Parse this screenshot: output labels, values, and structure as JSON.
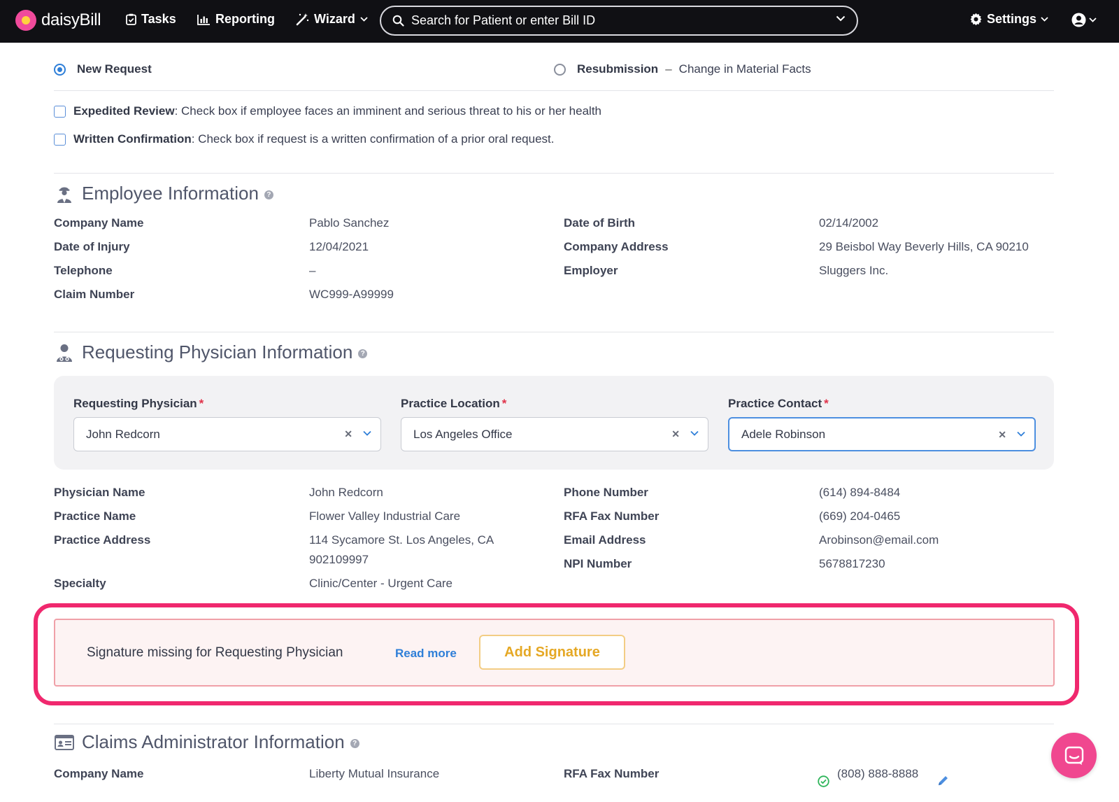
{
  "nav": {
    "brand": "daisyBill",
    "tasks": "Tasks",
    "reporting": "Reporting",
    "wizard": "Wizard",
    "search_placeholder": "Search for Patient or enter Bill ID",
    "settings": "Settings"
  },
  "request_type": {
    "new_request": "New Request",
    "resubmission": "Resubmission",
    "resubmission_dash": "–",
    "resubmission_detail": "Change in Material Facts",
    "selected": "New Request"
  },
  "checkboxes": [
    {
      "label": "Expedited Review",
      "text": ": Check box if employee faces an imminent and serious threat to his or her health"
    },
    {
      "label": "Written Confirmation",
      "text": ": Check box if request is a written confirmation of a prior oral request."
    }
  ],
  "employee": {
    "title": "Employee Information",
    "left": [
      {
        "label": "Company Name",
        "value": "Pablo Sanchez"
      },
      {
        "label": "Date of Injury",
        "value": "12/04/2021"
      },
      {
        "label": "Telephone",
        "value": "–"
      },
      {
        "label": "Claim Number",
        "value": "WC999-A99999"
      }
    ],
    "right": [
      {
        "label": "Date of Birth",
        "value": "02/14/2002"
      },
      {
        "label": "Company Address",
        "value": "29 Beisbol Way Beverly Hills, CA 90210"
      },
      {
        "label": "Employer",
        "value": "Sluggers Inc."
      }
    ]
  },
  "physician": {
    "title": "Requesting Physician Information",
    "selects": [
      {
        "label": "Requesting Physician",
        "required": "*",
        "value": "John Redcorn"
      },
      {
        "label": "Practice Location",
        "required": "*",
        "value": "Los Angeles Office"
      },
      {
        "label": "Practice Contact",
        "required": "*",
        "value": "Adele Robinson"
      }
    ],
    "left": [
      {
        "label": "Physician Name",
        "value": "John Redcorn"
      },
      {
        "label": "Practice Name",
        "value": "Flower Valley Industrial Care"
      },
      {
        "label": "Practice Address",
        "value": "114 Sycamore St. Los Angeles, CA",
        "value2": "902109997"
      },
      {
        "label": "Specialty",
        "value": "Clinic/Center - Urgent Care"
      }
    ],
    "right": [
      {
        "label": "Phone Number",
        "value": "(614) 894-8484"
      },
      {
        "label": "RFA Fax Number",
        "value": "(669) 204-0465"
      },
      {
        "label": "Email Address",
        "value": "Arobinson@email.com"
      },
      {
        "label": "NPI Number",
        "value": "5678817230"
      }
    ]
  },
  "alert": {
    "message": "Signature missing for Requesting Physician",
    "link": "Read more",
    "button": "Add Signature"
  },
  "claims_admin": {
    "title": "Claims Administrator Information",
    "company_label": "Company Name",
    "company_value": "Liberty Mutual Insurance",
    "fax_label": "RFA Fax Number",
    "fax_value": "(808) 888-8888"
  },
  "colors": {
    "nav_bg": "#101014",
    "accent_blue": "#2f7fd8",
    "alert_outline": "#f0286e",
    "alert_button_text": "#e5a825",
    "chat_bg": "#f0478f"
  }
}
